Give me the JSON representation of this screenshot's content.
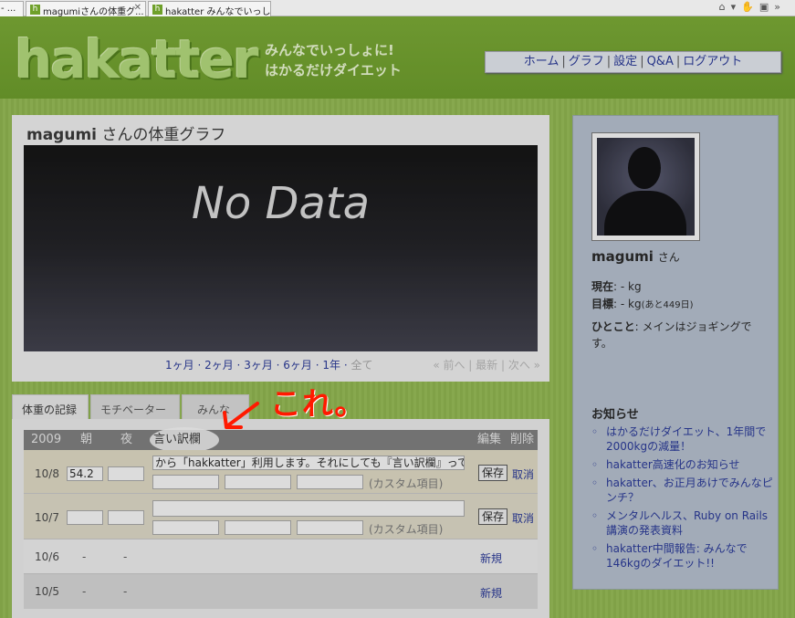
{
  "browser": {
    "tabs": [
      {
        "label": "- ...",
        "favicon": ""
      },
      {
        "label": "magumiさんの体重グ...",
        "favicon": "h"
      },
      {
        "label": "hakatter みんなでいっし...",
        "favicon": "h"
      }
    ],
    "toolbar_icons": [
      "home-icon",
      "dropdown-icon",
      "hand-icon",
      "rss-icon",
      "menu-icon"
    ]
  },
  "header": {
    "logo": "hakatter",
    "tagline_1": "みんなでいっしょに!",
    "tagline_2": "はかるだけダイエット",
    "nav": [
      "ホーム",
      "グラフ",
      "設定",
      "Q&A",
      "ログアウト"
    ]
  },
  "main": {
    "title_user": "magumi",
    "title_rest": "さんの体重グラフ",
    "graph_text": "No Data",
    "ranges": [
      "1ヶ月",
      "2ヶ月",
      "3ヶ月",
      "6ヶ月",
      "1年"
    ],
    "range_all": "全て",
    "pager": "« 前へ | 最新 | 次へ »"
  },
  "record": {
    "tabs": [
      "体重の記録",
      "モチベーター",
      "みんな"
    ],
    "header": {
      "year": "2009",
      "morning": "朝",
      "night": "夜",
      "excuse": "言い訳欄",
      "edit": "編集",
      "delete": "削除"
    },
    "rows": [
      {
        "date": "10/8",
        "morning": "54.2",
        "night": "",
        "excuse": "から「hakkatter」利用します。それにしても『言い訳欄』って(笑",
        "custom_label": "(カスタム項目)",
        "save": "保存",
        "cancel": "取消"
      },
      {
        "date": "10/7",
        "morning": "",
        "night": "",
        "excuse": "",
        "custom_label": "(カスタム項目)",
        "save": "保存",
        "cancel": "取消"
      },
      {
        "date": "10/6",
        "morning": "-",
        "night": "-",
        "new": "新規"
      },
      {
        "date": "10/5",
        "morning": "-",
        "night": "-",
        "new": "新規"
      }
    ]
  },
  "annotation": {
    "text": "これ。",
    "color": "#ff1a00"
  },
  "sidebar": {
    "user": "magumi",
    "san": "さん",
    "current_label": "現在",
    "current_value": ": - kg",
    "goal_label": "目標",
    "goal_value": ": - kg",
    "goal_note": "(あと449日)",
    "hitokoto_label": "ひとこと",
    "hitokoto_text": ": メインはジョギングです。",
    "news_title": "お知らせ",
    "news": [
      "はかるだけダイエット、1年間で2000kgの減量！",
      "hakatter高速化のお知らせ",
      "hakatter、お正月あけでみんなピンチ？",
      "メンタルヘルス、Ruby on Rails講演の発表資料",
      "hakatter中間報告: みんなで146kgのダイエット!!"
    ]
  },
  "colors": {
    "brand_green": "#79ac2e",
    "link": "#223399",
    "sidebar_bg": "#b9c4d4"
  }
}
